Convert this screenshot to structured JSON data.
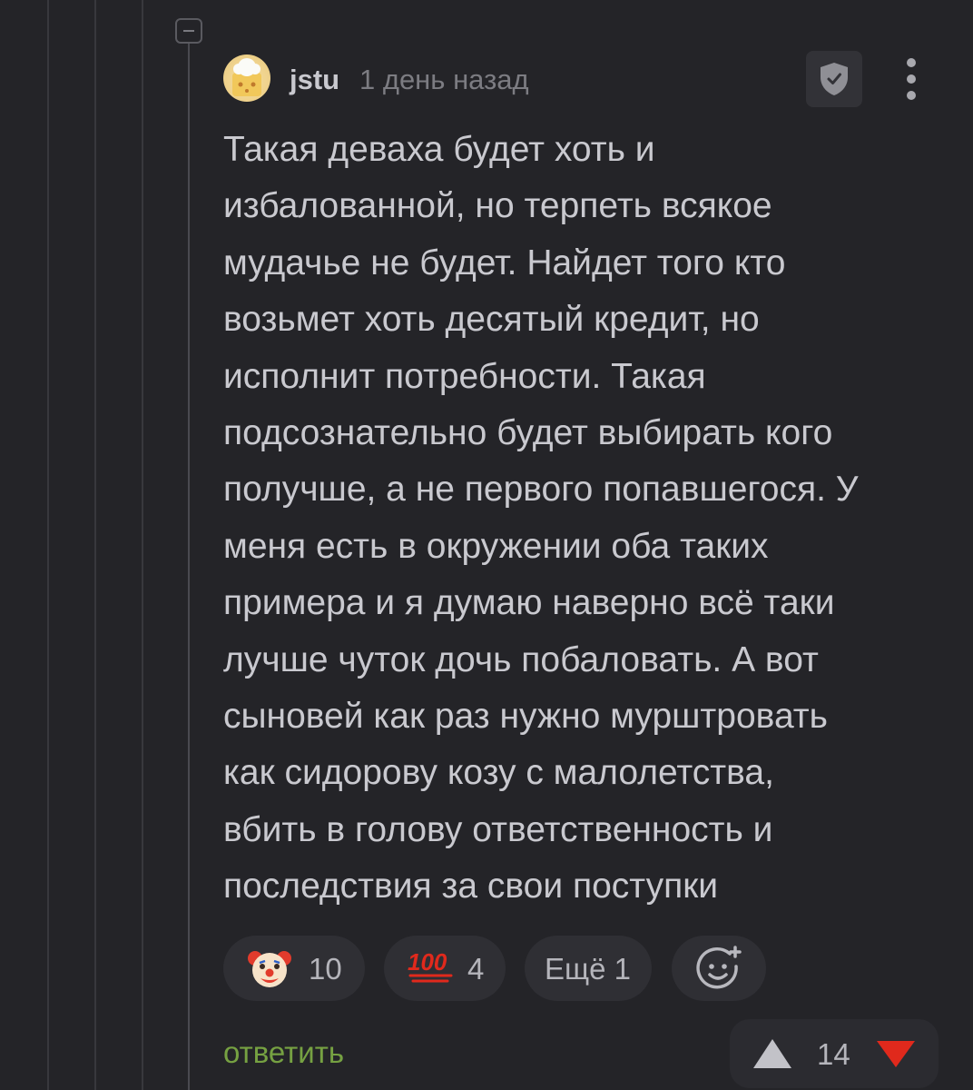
{
  "comment": {
    "author": "jstu",
    "timestamp": "1 день назад",
    "text_lines": [
      "Такая деваха будет хоть и",
      "избалованной, но терпеть всякое",
      "мудачье не будет. Найдет того кто",
      "возьмет хоть десятый кредит, но",
      "исполнит потребности. Такая",
      "подсознательно будет выбирать кого",
      "получше, а не первого попавшегося. У",
      "меня есть в окружении оба таких",
      "примера и я думаю наверно всё таки",
      "лучше чуток дочь побаловать. А вот",
      "сыновей как раз нужно мурштровать",
      "как сидорову козу с малолетства,",
      "вбить в голову ответственность и",
      "последствия за свои поступки"
    ],
    "reactions": [
      {
        "icon": "clown-face-icon",
        "count": "10"
      },
      {
        "icon": "hundred-points-icon",
        "count": "4"
      }
    ],
    "more_reactions_label": "Ещё 1",
    "add_reaction_icon": "smiley-plus-icon",
    "reply_label": "ответить",
    "rating": "14"
  },
  "colors": {
    "background": "#242428",
    "text": "#c9c9cf",
    "muted": "#7c7c82",
    "reply": "#76a142",
    "downvote": "#e0291c",
    "upvote": "#c2c2c8"
  }
}
